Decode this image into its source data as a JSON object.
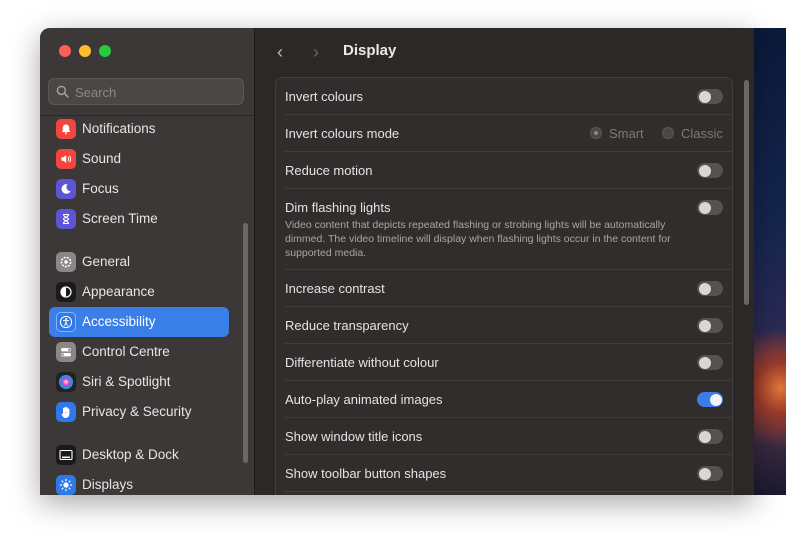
{
  "window": {
    "colors": {
      "close": "#fe5f57",
      "minimize": "#febc2e",
      "zoom": "#28c840"
    }
  },
  "search": {
    "placeholder": "Search"
  },
  "sidebar": {
    "items": [
      {
        "label": "Notifications",
        "icon": "bell-icon",
        "color": "#f0463f"
      },
      {
        "label": "Sound",
        "icon": "speaker-icon",
        "color": "#f0463f"
      },
      {
        "label": "Focus",
        "icon": "moon-icon",
        "color": "#5d55d6"
      },
      {
        "label": "Screen Time",
        "icon": "hourglass-icon",
        "color": "#5d55d6"
      },
      {
        "label": "General",
        "icon": "gear-icon",
        "color": "#8a8786"
      },
      {
        "label": "Appearance",
        "icon": "appearance-icon",
        "color": "#1a1a1a"
      },
      {
        "label": "Accessibility",
        "icon": "accessibility-icon",
        "color": "#2f78e8"
      },
      {
        "label": "Control Centre",
        "icon": "switches-icon",
        "color": "#8a8786"
      },
      {
        "label": "Siri & Spotlight",
        "icon": "siri-icon",
        "color": "#222222"
      },
      {
        "label": "Privacy & Security",
        "icon": "hand-icon",
        "color": "#2f78e8"
      },
      {
        "label": "Desktop & Dock",
        "icon": "dock-icon",
        "color": "#1a1a1a"
      },
      {
        "label": "Displays",
        "icon": "sun-icon",
        "color": "#2f78e8"
      }
    ]
  },
  "header": {
    "back": "‹",
    "forward": "›",
    "title": "Display"
  },
  "settings": [
    {
      "label": "Invert colours",
      "on": false
    },
    {
      "label": "Invert colours mode",
      "options": [
        "Smart",
        "Classic"
      ],
      "selected": "Smart"
    },
    {
      "label": "Reduce motion",
      "on": false
    },
    {
      "label": "Dim flashing lights",
      "description": "Video content that depicts repeated flashing or strobing lights will be automatically dimmed. The video timeline will display when flashing lights occur in the content for supported media.",
      "on": false
    },
    {
      "label": "Increase contrast",
      "on": false
    },
    {
      "label": "Reduce transparency",
      "on": false
    },
    {
      "label": "Differentiate without colour",
      "on": false
    },
    {
      "label": "Auto-play animated images",
      "on": true
    },
    {
      "label": "Show window title icons",
      "on": false
    },
    {
      "label": "Show toolbar button shapes",
      "on": false
    }
  ]
}
